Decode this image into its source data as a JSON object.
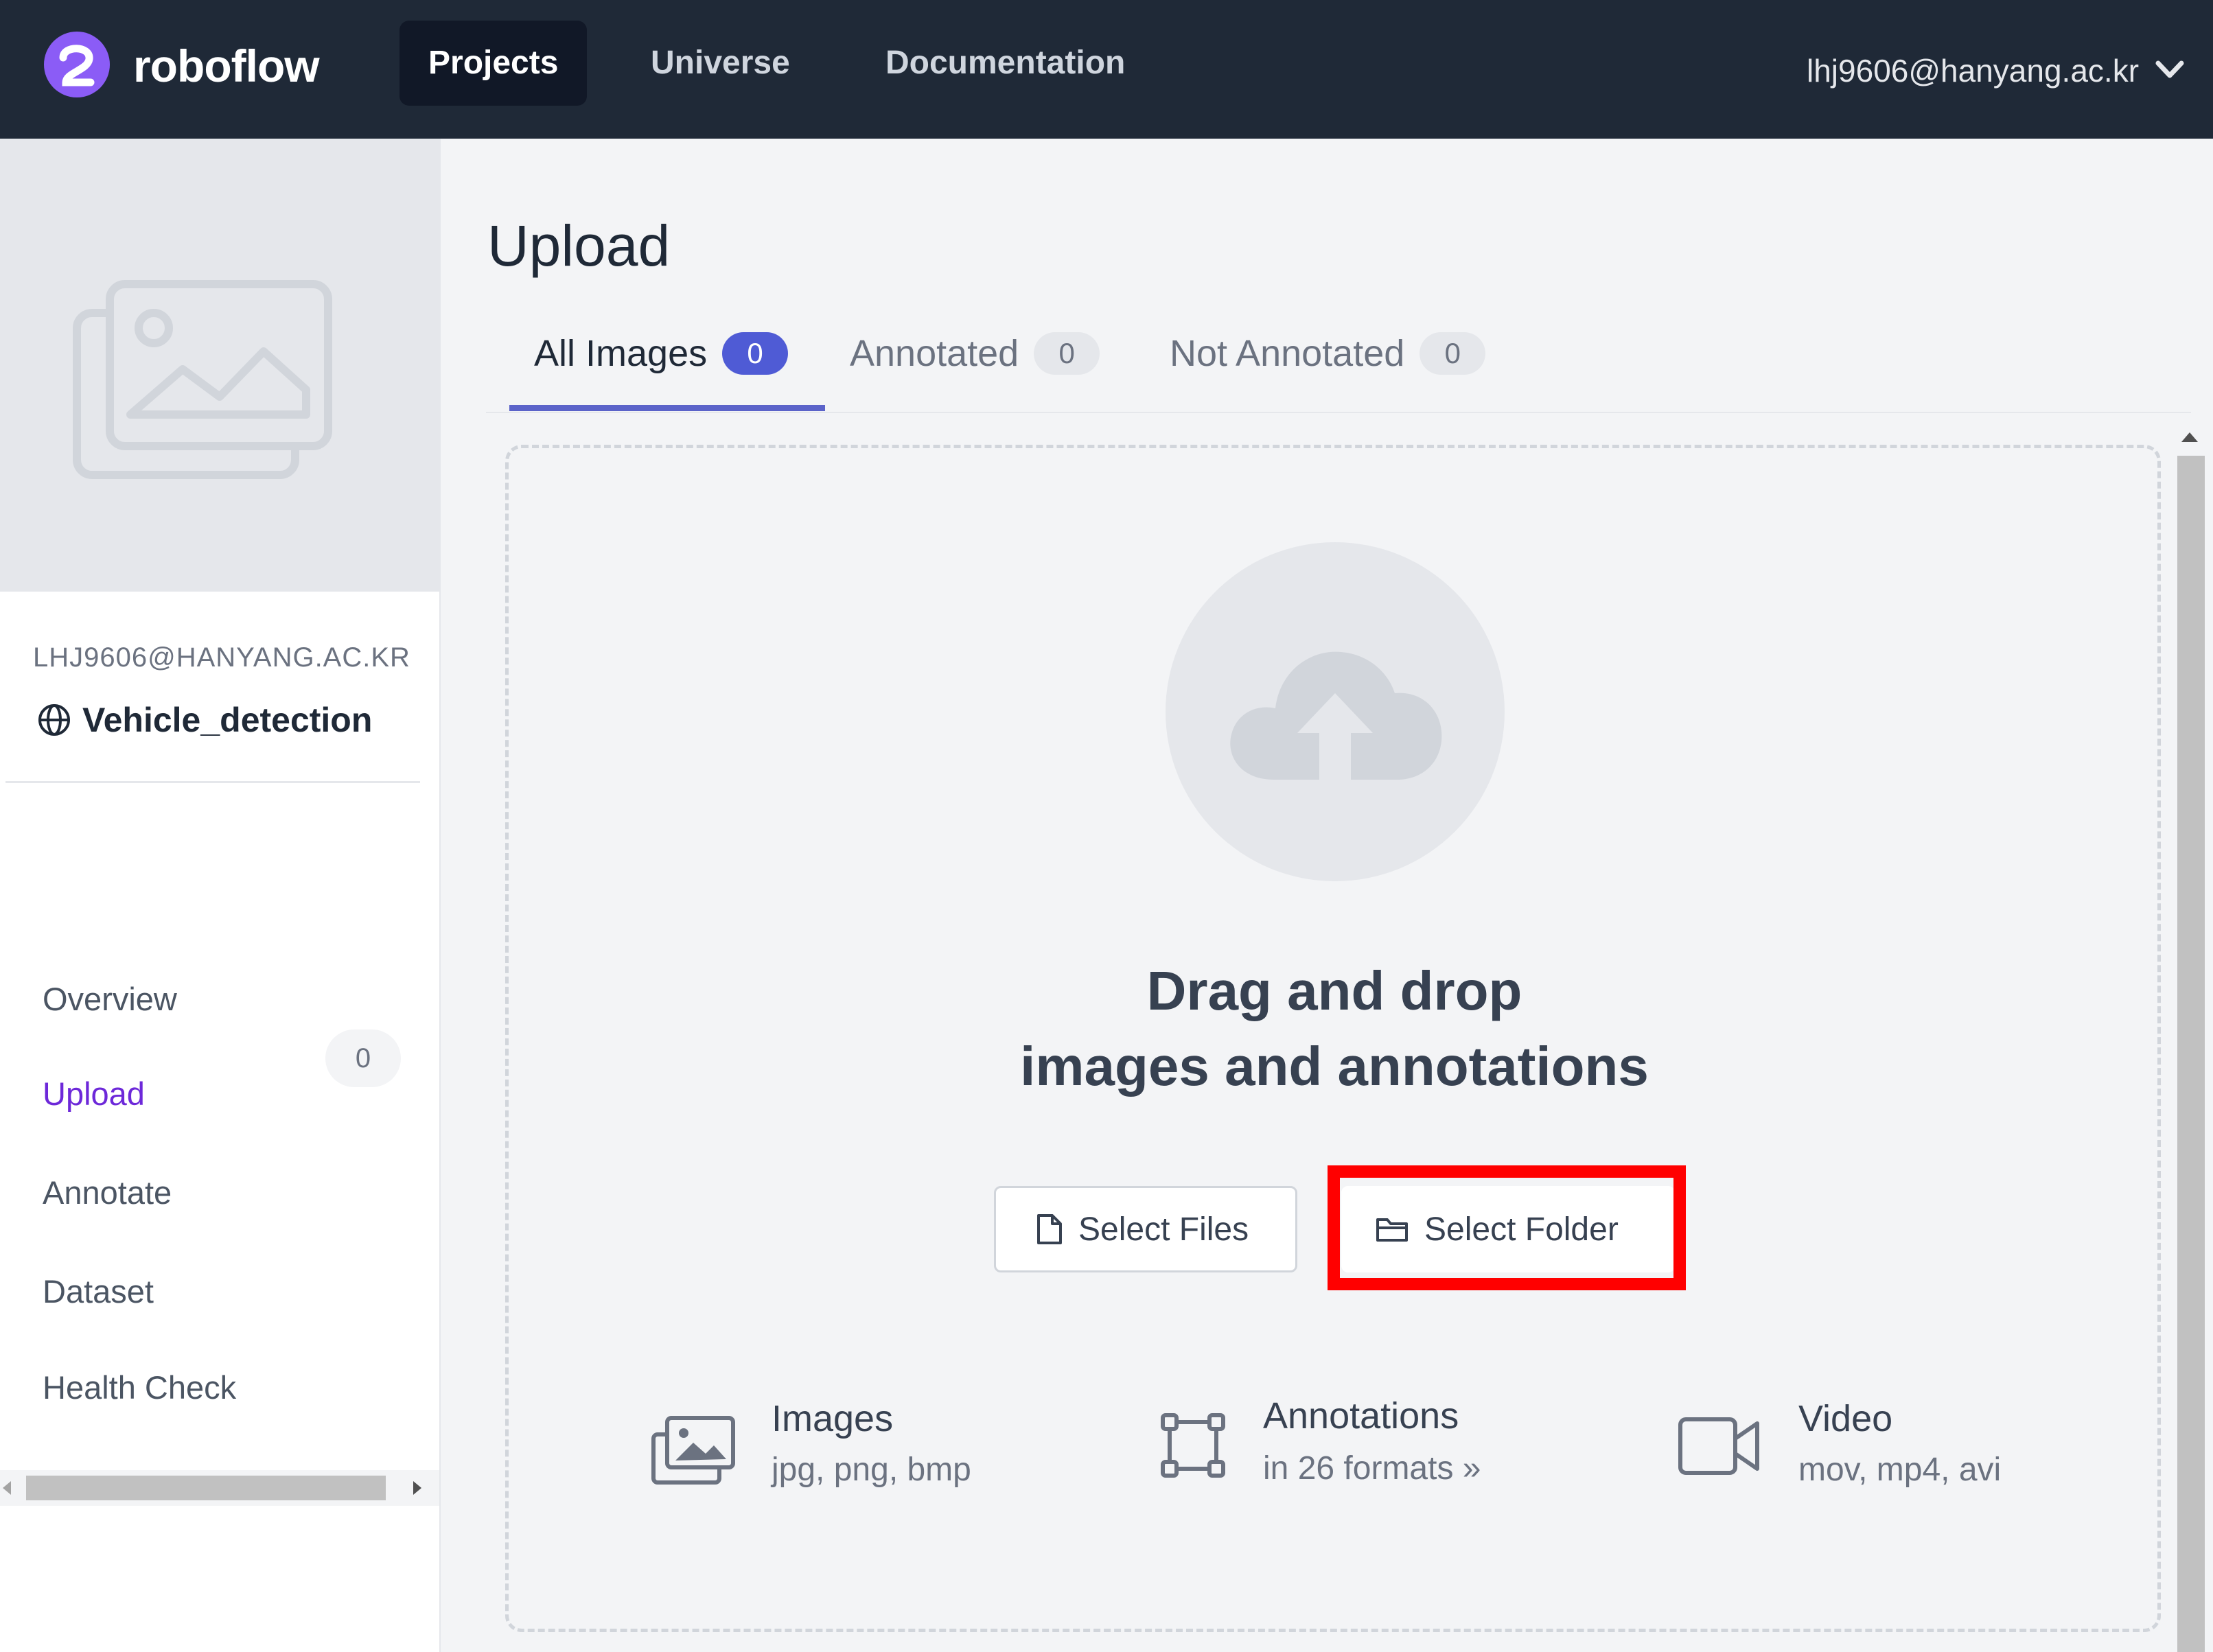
{
  "nav": {
    "brand": "roboflow",
    "items": [
      "Projects",
      "Universe",
      "Documentation"
    ],
    "active": "Projects",
    "user_email": "lhj9606@hanyang.ac.kr"
  },
  "sidebar": {
    "workspace": "LHJ9606@HANYANG.AC.KR",
    "project_name": "Vehicle_detection",
    "links": [
      "Overview",
      "Upload",
      "Annotate",
      "Dataset",
      "Health Check"
    ],
    "active": "Upload",
    "annotate_count": "0"
  },
  "main": {
    "title": "Upload",
    "tabs": [
      {
        "label": "All Images",
        "count": "0"
      },
      {
        "label": "Annotated",
        "count": "0"
      },
      {
        "label": "Not Annotated",
        "count": "0"
      }
    ],
    "active_tab": "All Images",
    "drop_title_line1": "Drag and drop",
    "drop_title_line2": "images and annotations",
    "select_files": "Select Files",
    "select_folder": "Select Folder",
    "features": [
      {
        "title": "Images",
        "subtitle": "jpg, png, bmp",
        "icon": "images-icon"
      },
      {
        "title": "Annotations",
        "subtitle": "in 26 formats »",
        "icon": "bounding-box-icon"
      },
      {
        "title": "Video",
        "subtitle": "mov, mp4, avi",
        "icon": "video-camera-icon"
      }
    ]
  },
  "colors": {
    "nav_bg": "#1f2937",
    "accent": "#4f5bd5",
    "active_link": "#6d28d9",
    "highlight": "#ff0000"
  }
}
